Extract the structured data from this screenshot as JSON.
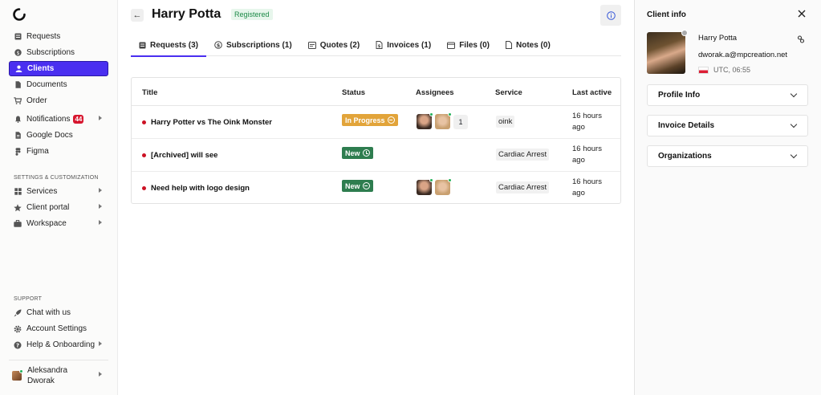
{
  "sidebar": {
    "items_main": [
      {
        "label": "Requests",
        "icon": "requests-icon"
      },
      {
        "label": "Subscriptions",
        "icon": "dollar-icon"
      },
      {
        "label": "Clients",
        "icon": "clients-icon",
        "active": true
      },
      {
        "label": "Documents",
        "icon": "document-icon"
      },
      {
        "label": "Order",
        "icon": "cart-icon"
      },
      {
        "label": "Notifications",
        "icon": "bell-icon",
        "badge": "44"
      },
      {
        "label": "Google Docs",
        "icon": "google-docs-icon"
      },
      {
        "label": "Figma",
        "icon": "figma-icon"
      }
    ],
    "settings_title": "SETTINGS & CUSTOMIZATION",
    "items_settings": [
      {
        "label": "Services",
        "icon": "grid-icon"
      },
      {
        "label": "Client portal",
        "icon": "star-icon"
      },
      {
        "label": "Workspace",
        "icon": "briefcase-icon"
      }
    ],
    "support_title": "SUPPORT",
    "items_support": [
      {
        "label": "Chat with us",
        "icon": "rocket-icon"
      },
      {
        "label": "Account Settings",
        "icon": "gear-icon"
      },
      {
        "label": "Help & Onboarding",
        "icon": "help-icon"
      }
    ],
    "user": {
      "first": "Aleksandra",
      "last": "Dworak"
    }
  },
  "header": {
    "title": "Harry Potta",
    "status_badge": "Registered"
  },
  "tabs": [
    {
      "label": "Requests (3)",
      "icon": "requests-icon",
      "active": true
    },
    {
      "label": "Subscriptions (1)",
      "icon": "dollar-icon"
    },
    {
      "label": "Quotes (2)",
      "icon": "quote-icon"
    },
    {
      "label": "Invoices (1)",
      "icon": "invoice-icon"
    },
    {
      "label": "Files (0)",
      "icon": "folder-icon"
    },
    {
      "label": "Notes (0)",
      "icon": "note-icon"
    }
  ],
  "table": {
    "headers": {
      "title": "Title",
      "status": "Status",
      "assignees": "Assignees",
      "service": "Service",
      "last_active": "Last active"
    },
    "rows": [
      {
        "title": "Harry Potter vs The Oink Monster",
        "status": "In Progress",
        "status_color": "#e2a43a",
        "status_icon": "minus",
        "assignees_extra": "1",
        "service": "oink",
        "last_active": "16 hours ago"
      },
      {
        "title": "[Archived] will see",
        "status": "New",
        "status_color": "#2e7d4f",
        "status_icon": "clock",
        "assignees_extra": "",
        "service": "Cardiac Arrest",
        "last_active": "16 hours ago"
      },
      {
        "title": "Need help with logo design",
        "status": "New",
        "status_color": "#2e7d4f",
        "status_icon": "minus",
        "assignees_extra": "",
        "service": "Cardiac Arrest",
        "last_active": "16 hours ago"
      }
    ]
  },
  "panel": {
    "title": "Client info",
    "client_name": "Harry Potta",
    "client_email": "dworak.a@mpcreation.net",
    "timezone": "UTC, 06:55",
    "sections": {
      "profile": "Profile Info",
      "invoice": "Invoice Details",
      "organizations": "Organizations"
    }
  },
  "colors": {
    "accent": "#4a2ff0",
    "in_progress": "#e2a43a",
    "new": "#2e7d4f",
    "danger": "#d7172f"
  }
}
